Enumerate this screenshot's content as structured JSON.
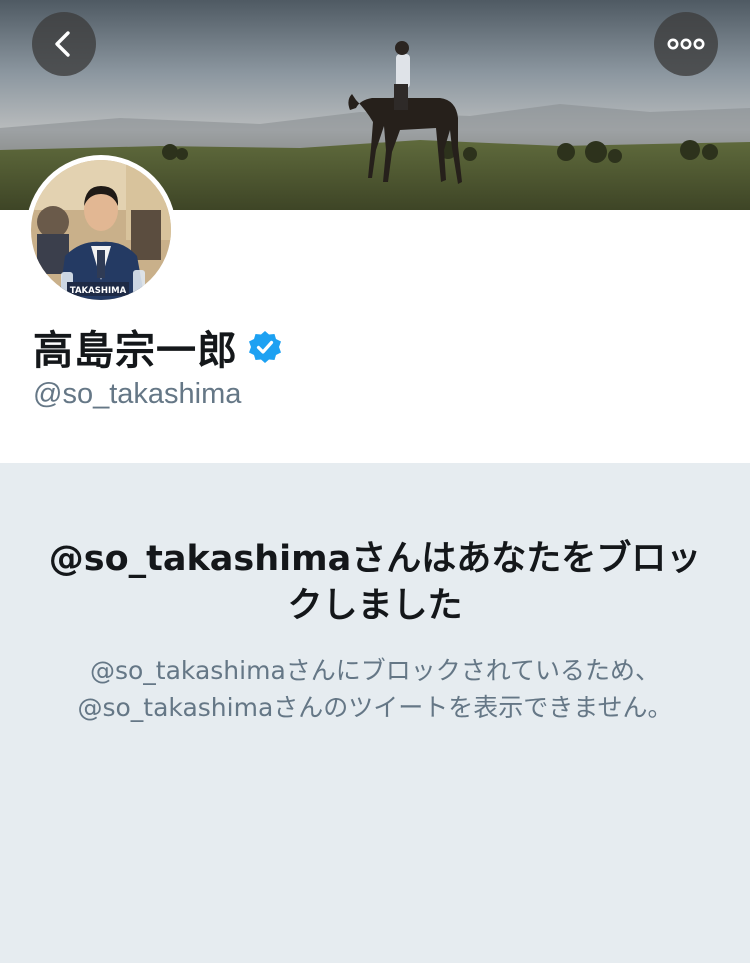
{
  "header": {
    "back_icon": "chevron-left-icon",
    "more_icon": "more-horizontal-icon"
  },
  "banner": {
    "description_icon": "banner-image"
  },
  "profile": {
    "display_name": "高島宗一郎",
    "verified_icon": "verified-badge-icon",
    "handle": "@so_takashima",
    "avatar_nameplate": "TAKASHIMA"
  },
  "blocked": {
    "title": "@so_takashimaさんはあなたをブロックしました",
    "description": "@so_takashimaさんにブロックされているため、@so_takashimaさんのツイートを表示できません。"
  },
  "colors": {
    "background": "#e6ecf0",
    "verified_blue": "#1da1f2",
    "text_primary": "#14171a",
    "text_secondary": "#657786"
  }
}
